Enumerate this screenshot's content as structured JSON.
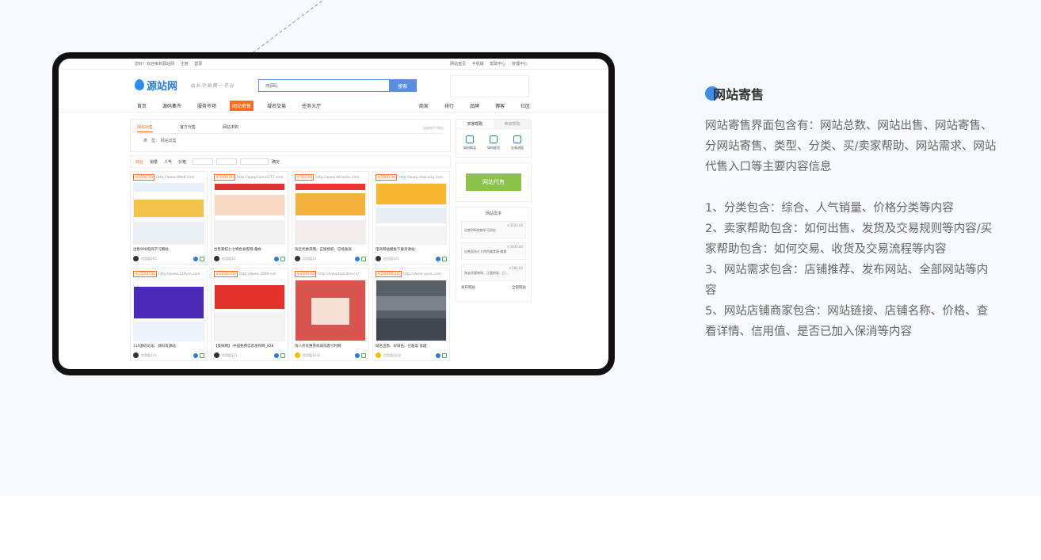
{
  "screen": {
    "topbar": {
      "left": [
        "您好！欢迎来到源站网",
        "注册",
        "登录"
      ],
      "right": [
        "网站首页",
        "手机版",
        "帮助中心",
        "管理中心"
      ]
    },
    "header": {
      "logo": "源站网",
      "slogan": "站长交易第一平台",
      "search_placeholder": "搜源码",
      "search_button": "搜索"
    },
    "nav": {
      "left": [
        "首页",
        "源码集市",
        "服务市场",
        "网站寄售",
        "域名交易",
        "任务大厅"
      ],
      "active": "网站寄售",
      "right": [
        "商家",
        "排行",
        "品牌",
        "博客",
        "社区"
      ]
    },
    "tabs": [
      "网站出售",
      "官方代售",
      "网站求购"
    ],
    "tabs_right": "当前有9个网站",
    "type_label": "类　型：",
    "type_value": "网站出售",
    "filter": [
      "综合",
      "销量",
      "人气",
      "价格"
    ],
    "filter_confirm": "确定",
    "cards": [
      {
        "price": "￥5000.00",
        "url": "http://www.99e8.com",
        "title": "出售998电商学习网站",
        "user": "信用值565"
      },
      {
        "price": "￥5000.00",
        "url": "http://www.home177.com",
        "title": "出售家纺七七特色食客网-趣食",
        "user": "信用值33"
      },
      {
        "price": "￥500.00",
        "url": "http://www.ditianhu.com",
        "title": "淘宝优惠券网、正版授权、已经备案",
        "user": "信用值33"
      },
      {
        "price": "￥5000.00",
        "url": "http://www.diqiceng.com",
        "title": "电商网站模板下载资源站",
        "user": "信用值121"
      },
      {
        "price": "￥15000.00",
        "url": "http://www.119ym.com",
        "title": "119源码论坛、源码资源站",
        "user": "信用值121"
      },
      {
        "price": "￥16000.00",
        "url": "http://www.3008.net",
        "title": "【奥抹网】-中国免费信息发布网_828",
        "user": "信用值121"
      },
      {
        "price": "￥2000.00",
        "url": "http://www.taolizhe.cn/",
        "title": "淘八折优惠券商城淘客引利网",
        "user": "信用值3232"
      },
      {
        "price": "￥200000.00",
        "url": "http://www.uyue.com",
        "title": "域名出售、好域名、已备案 优越",
        "user": "信用值3232"
      }
    ],
    "side": {
      "tabs": [
        "买家帮助",
        "卖家帮助"
      ],
      "help": [
        "如何购买",
        "如何收货",
        "交易流程"
      ],
      "agent_button": "网站代售",
      "demand_title": "网站需求",
      "demands": [
        {
          "price": "￥5000.00",
          "text": "出售998电商学习网站"
        },
        {
          "price": "￥5000.00",
          "text": "出售家纺七七特色美食网-趣食"
        },
        {
          "price": "￥580.00",
          "text": "淘宝优惠券网、正版授权、已..."
        }
      ],
      "publish": "发布网站",
      "all": "全部网站"
    }
  },
  "text": {
    "heading": "网站寄售",
    "description": "网站寄售界面包含有：网站总数、网站出售、网站寄售、分网站寄售、类型、分类、买/卖家帮助、网站需求、网站代售入口等主要内容信息",
    "items": [
      "1、分类包含：综合、人气销量、价格分类等内容",
      "2、卖家帮助包含：如何出售、发货及交易规则等内容/买家帮助包含：如何交易、收货及交易流程等内容",
      "3、网站需求包含：店铺推荐、发布网站、全部网站等内容",
      "5、网站店铺商家包含：网站链接、店铺名称、价格、查看详情、信用值、是否已加入保消等内容"
    ]
  },
  "colors": {
    "accent": "#ff6b1a",
    "blue": "#3d8ee8",
    "green": "#8bc34a"
  }
}
